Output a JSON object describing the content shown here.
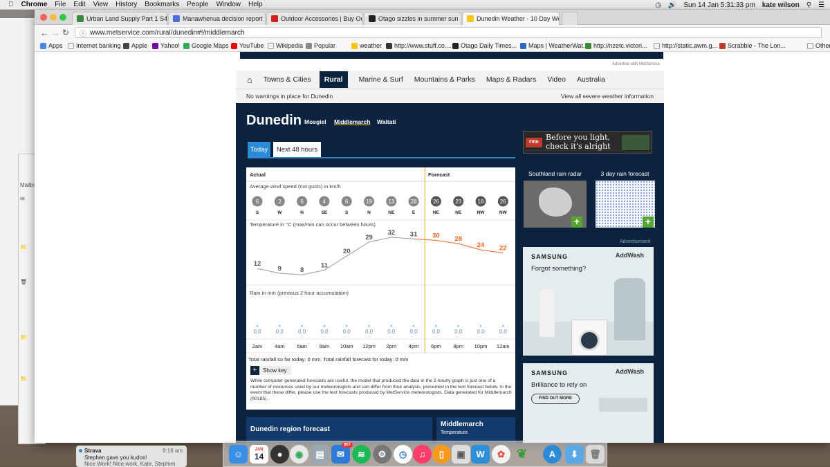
{
  "menubar": {
    "app": "Chrome",
    "items": [
      "File",
      "Edit",
      "View",
      "History",
      "Bookmarks",
      "People",
      "Window",
      "Help"
    ],
    "clock": "Sun 14 Jan  5:31:33 pm",
    "user": "kate wilson"
  },
  "tabs": [
    {
      "label": "Urban Land Supply Part 1 S4"
    },
    {
      "label": "Manawhenua decision report"
    },
    {
      "label": "Outdoor Accessories | Buy Ou"
    },
    {
      "label": "Otago sizzles in summer sun"
    },
    {
      "label": "Dunedin Weather - 10 Day We"
    }
  ],
  "url": "www.metservice.com/rural/dunedin#!/middlemarch",
  "bookmarks": [
    "Apps",
    "Internet banking",
    "Apple",
    "Yahoo!",
    "Google Maps",
    "YouTube",
    "Wikipedia",
    "Popular",
    "weather",
    "http://www.stuff.co....",
    "Otago Daily Times...",
    "Maps | WeatherWat...",
    "http://nzetc.victori...",
    "http://static.awm.g...",
    "Scrabble - The Lon...",
    "Other"
  ],
  "page": {
    "advertise": "Advertise with MetService",
    "nav": [
      "Towns & Cities",
      "Rural",
      "Marine & Surf",
      "Mountains & Parks",
      "Maps & Radars",
      "Video",
      "Australia"
    ],
    "warning": "No warnings in place for Dunedin",
    "severe_link": "View all severe weather information",
    "city": "Dunedin",
    "subs": [
      "Mosgiel",
      "Middlemarch",
      "Waitati"
    ],
    "tab_today": "Today",
    "tab_48": "Next 48 hours",
    "fire_ad": {
      "line1": "Before you light,",
      "line2": "check it's alright",
      "badge": "FIRE"
    },
    "chart": {
      "actual_label": "Actual",
      "forecast_label": "Forecast",
      "wind_title": "Average wind speed (not gusts) in km/h",
      "temp_title": "Temperature in °C (max/min can occur between hours)",
      "rain_title": "Rain in mm (previous 2 hour accumulation)",
      "total_text": "Total rainfall so far today: 0 mm. Total rainfall forecast for today: 0 mm",
      "show_key": "Show key",
      "disclaimer": "While computer generated forecasts are useful, the model that produced the data in the 2-hourly graph is just one of a number of resources used by our meteorologists and can differ from their analysis, presented in the text forecast below. In the event that these differ, please use the text forecasts produced by MetService meteorologists. Data generated for Middlemarch (90185)."
    },
    "side": {
      "rain_radar": "Southland rain radar",
      "rain_forecast": "3 day rain forecast"
    },
    "advertisement": "Advertisement",
    "ad1": {
      "brand": "SAMSUNG",
      "product": "AddWash",
      "text": "Forgot something?"
    },
    "ad2": {
      "brand": "SAMSUNG",
      "product": "AddWash",
      "text": "Brilliance to rely on",
      "cta": "FIND OUT MORE"
    },
    "region": "Dunedin region forecast",
    "mid_title": "Middlemarch",
    "mid_sub": "Temperature"
  },
  "notification": {
    "app": "Strava",
    "time": "9:18 am",
    "line1": "Stephen gave you kudos!",
    "line2": "Nice Work! Nice work, Kate. Stephen"
  },
  "dock_badge": "867",
  "calendar": {
    "month": "JAN",
    "day": "14"
  },
  "chart_data": {
    "type": "line",
    "times": [
      "2am",
      "4am",
      "6am",
      "8am",
      "10am",
      "12pm",
      "2pm",
      "4pm",
      "6pm",
      "8pm",
      "10pm",
      "12am"
    ],
    "actual_count": 8,
    "wind_speed": [
      6,
      2,
      6,
      4,
      6,
      19,
      13,
      28,
      26,
      23,
      18,
      26
    ],
    "wind_dir": [
      "S",
      "W",
      "N",
      "SE",
      "S",
      "N",
      "NE",
      "E",
      "NE",
      "NE",
      "NW",
      "NW"
    ],
    "temperature": [
      12,
      9,
      8,
      11,
      20,
      29,
      32,
      31,
      30,
      28,
      24,
      22
    ],
    "rain": [
      "0.0",
      "0.0",
      "0.0",
      "0.0",
      "0.0",
      "0.0",
      "0.0",
      "0.0",
      "0.0",
      "0.0",
      "0.0",
      "0.0"
    ],
    "actual_color": "#999999",
    "forecast_color": "#f26522",
    "divider_color": "#f0a830"
  }
}
